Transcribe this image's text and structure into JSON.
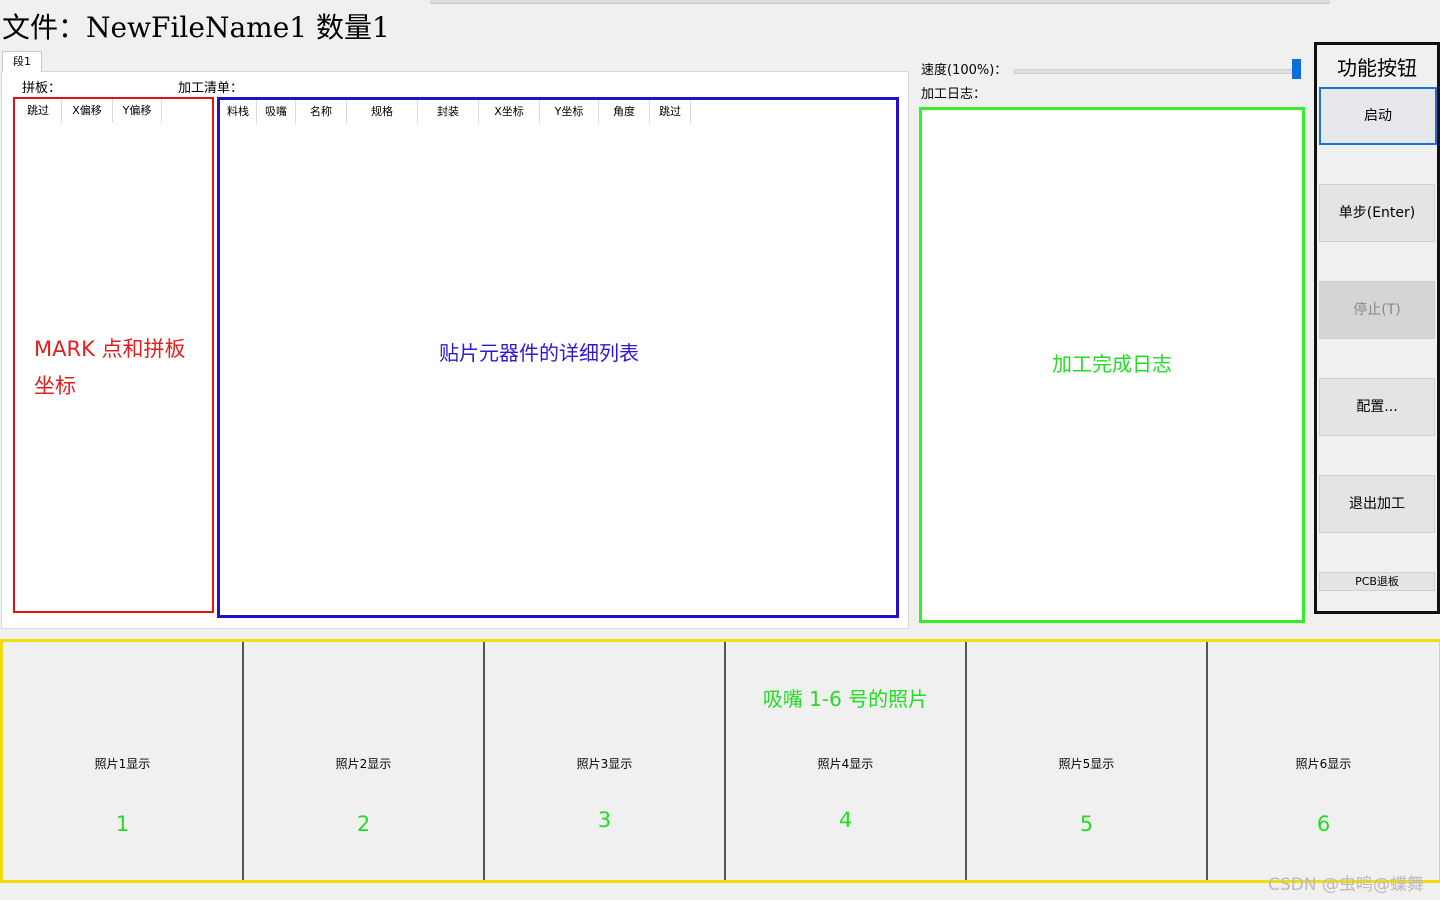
{
  "header": {
    "file_title": "文件：NewFileName1 数量1"
  },
  "tab": {
    "label": "段1"
  },
  "panel": {
    "panel_label": "拼板：",
    "process_label": "加工清单："
  },
  "mark_table": {
    "columns": [
      "跳过",
      "X偏移",
      "Y偏移"
    ]
  },
  "process_table": {
    "columns": [
      "料栈",
      "吸嘴",
      "名称",
      "规格",
      "封装",
      "X坐标",
      "Y坐标",
      "角度",
      "跳过"
    ]
  },
  "speed": {
    "label": "速度(100%)：",
    "value_percent": 100
  },
  "log": {
    "label": "加工日志："
  },
  "annotations": {
    "mark": "MARK 点和拼板坐标",
    "list": "贴片元器件的详细列表",
    "log": "加工完成日志",
    "nozzle": "吸嘴 1-6 号的照片"
  },
  "function_panel": {
    "title": "功能按钮",
    "buttons": {
      "start": "启动",
      "step": "单步(Enter)",
      "stop": "停止(T)",
      "config": "配置...",
      "exit": "退出加工",
      "pcb_exit": "PCB退板"
    }
  },
  "photos": [
    {
      "caption": "照片1显示",
      "number": "1"
    },
    {
      "caption": "照片2显示",
      "number": "2"
    },
    {
      "caption": "照片3显示",
      "number": "3"
    },
    {
      "caption": "照片4显示",
      "number": "4"
    },
    {
      "caption": "照片5显示",
      "number": "5"
    },
    {
      "caption": "照片6显示",
      "number": "6"
    }
  ],
  "watermark": "CSDN @虫鸣@蝶舞",
  "colors": {
    "mark_box": "#e01414",
    "list_box": "#2211cc",
    "log_box": "#33ee22",
    "function_box": "#111111",
    "photo_box": "#f0dd10",
    "slider": "#0a6fd8"
  }
}
